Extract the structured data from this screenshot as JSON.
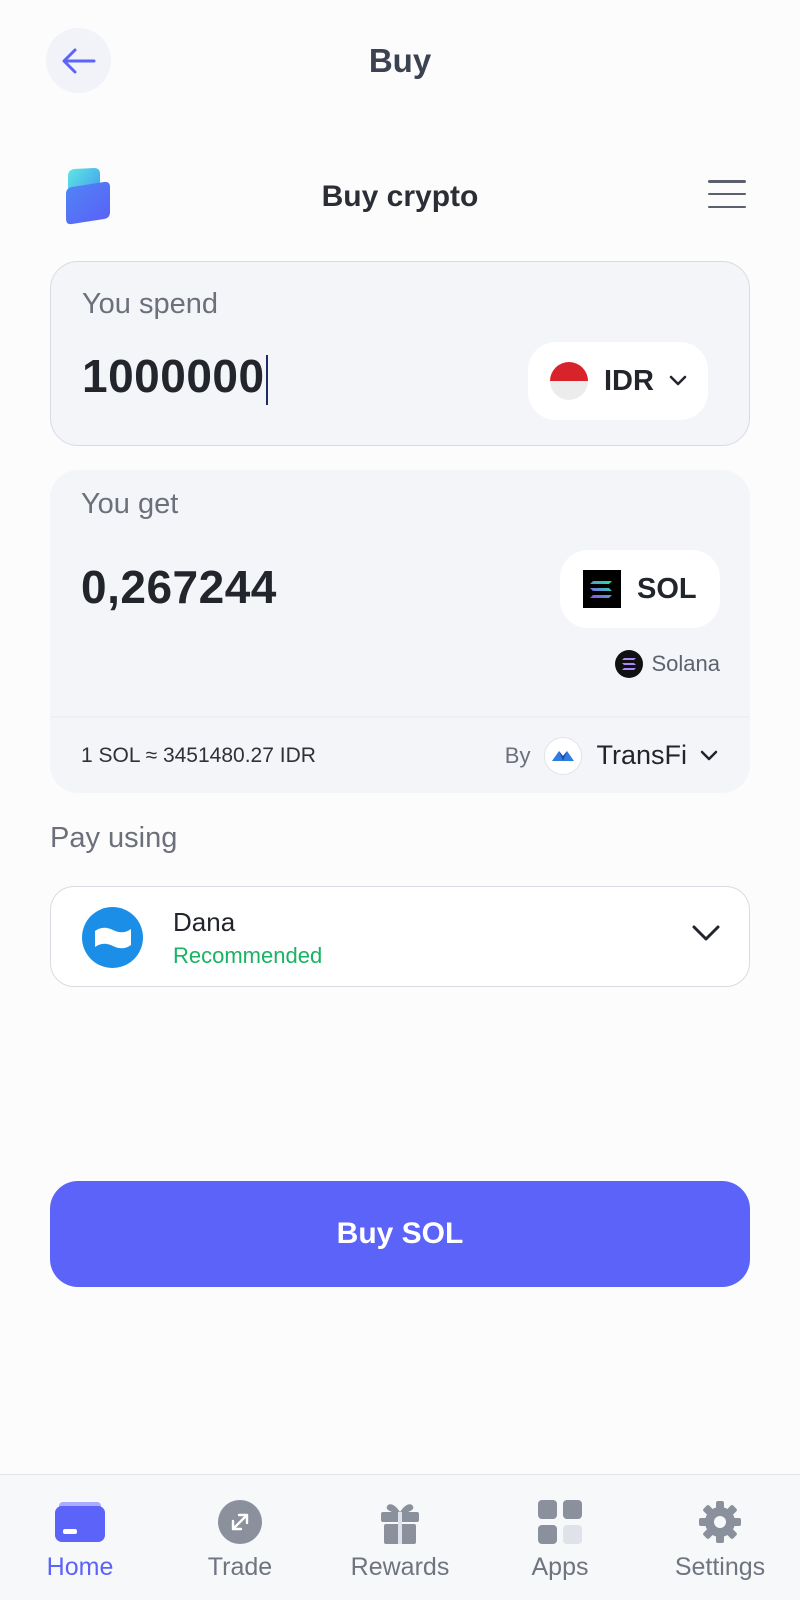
{
  "header": {
    "title": "Buy"
  },
  "widget": {
    "title": "Buy crypto"
  },
  "spend": {
    "label": "You spend",
    "amount": "1000000",
    "currency": "IDR"
  },
  "receive": {
    "label": "You get",
    "amount": "0,267244",
    "currency": "SOL",
    "network": "Solana"
  },
  "rate": {
    "text": "1 SOL ≈ 3451480.27 IDR",
    "by_label": "By",
    "provider": "TransFi"
  },
  "payment": {
    "label": "Pay using",
    "method": "Dana",
    "tag": "Recommended"
  },
  "buy_button": {
    "label": "Buy SOL"
  },
  "nav": {
    "items": [
      {
        "label": "Home",
        "icon": "wallet-icon",
        "active": true
      },
      {
        "label": "Trade",
        "icon": "trade-icon",
        "active": false
      },
      {
        "label": "Rewards",
        "icon": "gift-icon",
        "active": false
      },
      {
        "label": "Apps",
        "icon": "apps-grid-icon",
        "active": false
      },
      {
        "label": "Settings",
        "icon": "gear-icon",
        "active": false
      }
    ]
  },
  "colors": {
    "accent": "#5c63f8",
    "success": "#19b364",
    "card_bg": "#f4f5f8",
    "indonesia_red": "#d8232a"
  }
}
